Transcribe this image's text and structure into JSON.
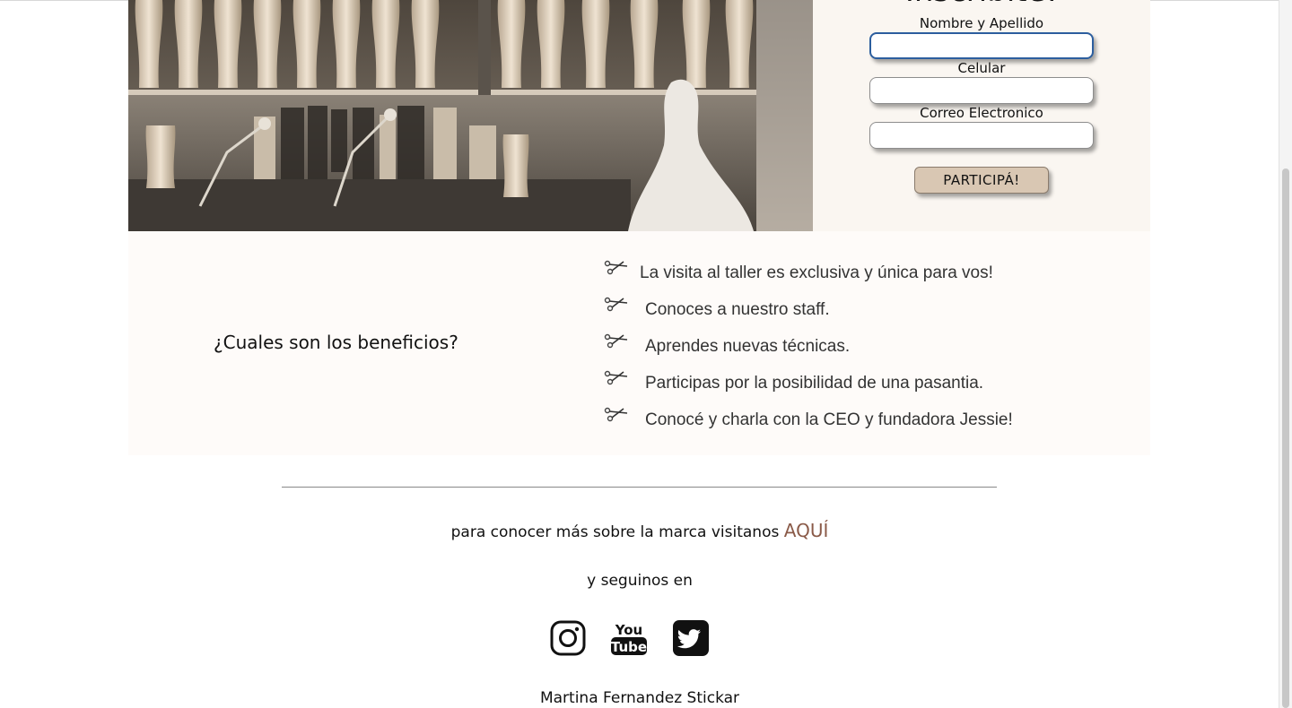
{
  "form": {
    "heading": "Inscribite!",
    "fields": [
      {
        "label": "Nombre y Apellido",
        "value": "",
        "placeholder": ""
      },
      {
        "label": "Celular",
        "value": "",
        "placeholder": ""
      },
      {
        "label": "Correo Electronico",
        "value": "",
        "placeholder": ""
      }
    ],
    "submit_label": "PARTICIPÁ!"
  },
  "benefits": {
    "title": "¿Cuales son los beneficios?",
    "items": [
      "La visita al taller es exclusiva y única para vos!",
      "Conoces a nuestro staff.",
      "Aprendes nuevas técnicas.",
      "Participas por la posibilidad de una pasantia.",
      "Conocé y charla con la CEO y fundadora Jessie!"
    ],
    "bullet_icon": "scissors-icon"
  },
  "footer": {
    "learn_more_text": "para conocer más sobre la marca visitanos",
    "learn_more_link": "AQUÍ",
    "follow_text": "y seguinos en",
    "social": [
      {
        "name": "instagram-icon"
      },
      {
        "name": "youtube-icon",
        "lines": [
          "You",
          "Tube"
        ]
      },
      {
        "name": "twitter-icon"
      }
    ],
    "credit": "Martina Fernandez Stickar"
  },
  "colors": {
    "form_bg": "#faf6f1",
    "benefits_bg": "#fefbf9",
    "button_bg": "#d9c7b3",
    "link": "#8a5a48",
    "input_focus": "#2c5e9e"
  }
}
